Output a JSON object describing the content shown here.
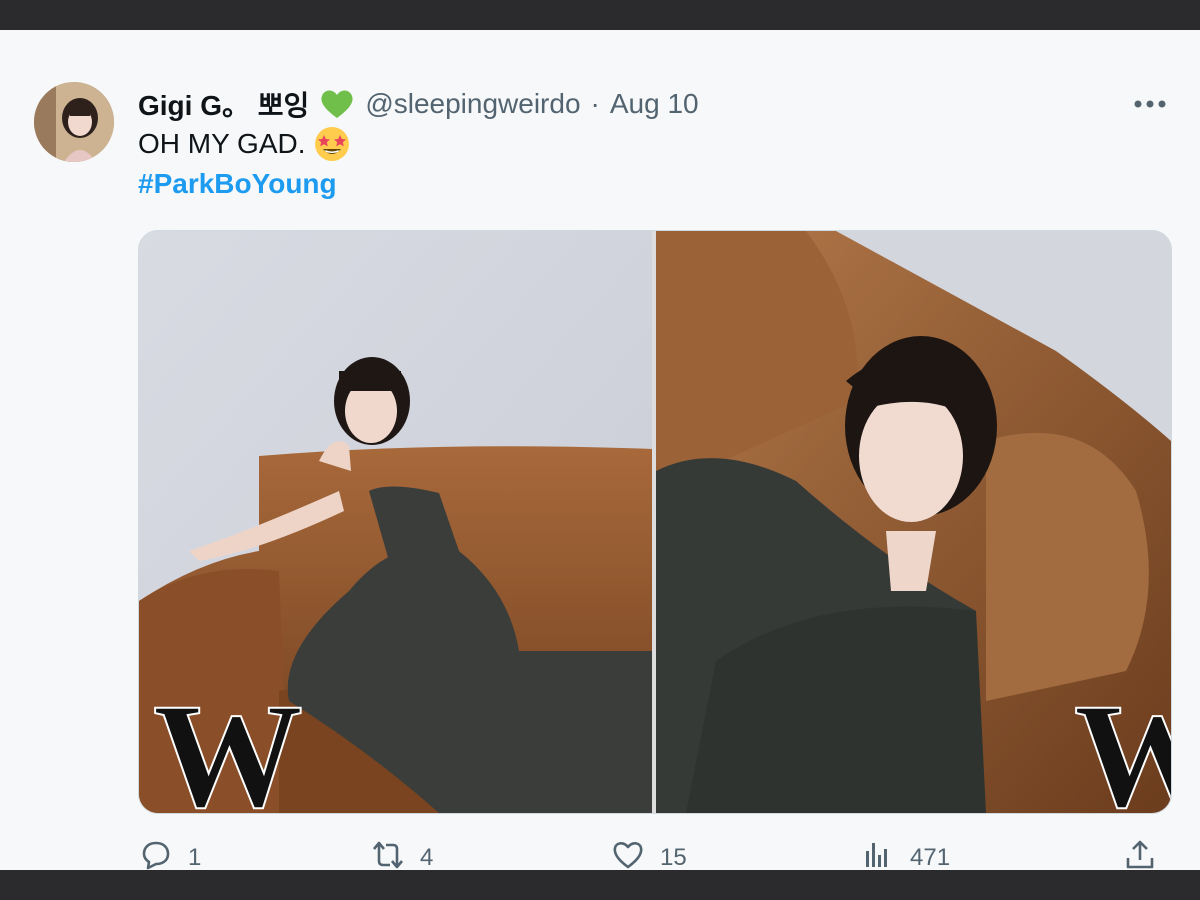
{
  "tweet": {
    "display_name": "Gigi G。 뽀잉",
    "heart_emoji": "green-heart-icon",
    "handle": "@sleepingweirdo",
    "separator": "·",
    "date": "Aug 10",
    "text": "OH MY GAD.",
    "text_emoji": "star-struck-emoji-icon",
    "hashtag": "#ParkBoYoung"
  },
  "media": {
    "left_logo": "W",
    "right_logo": "W"
  },
  "actions": {
    "replies": "1",
    "retweets": "4",
    "likes": "15",
    "views": "471"
  },
  "colors": {
    "link": "#1d9bf0",
    "muted": "#536471",
    "text": "#0f1419",
    "green_heart": "#6fbf4a"
  }
}
